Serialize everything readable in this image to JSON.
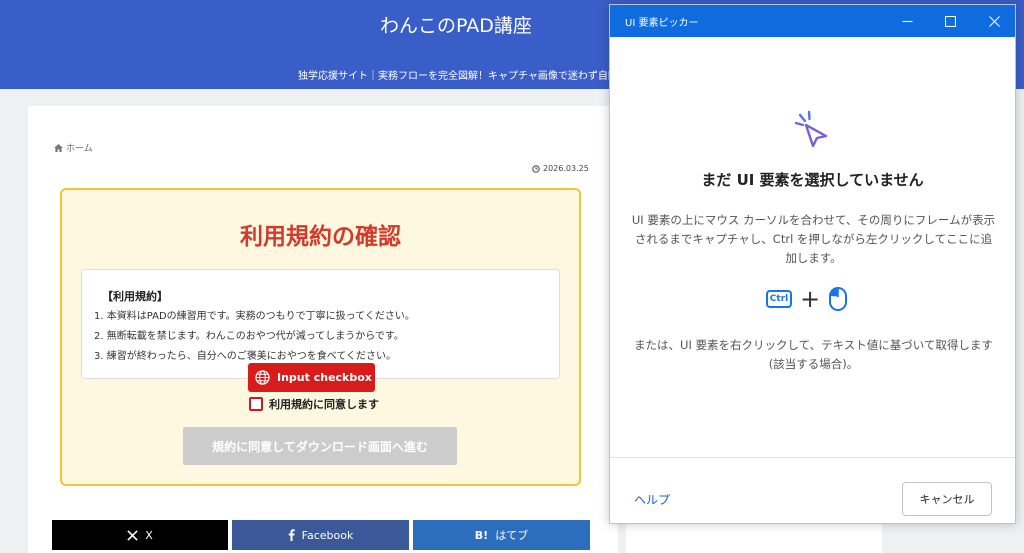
{
  "site": {
    "title": "わんこのPAD講座",
    "tagline": "独学応援サイト｜実務フローを完全図解！キャプチャ画像で迷わず自動化"
  },
  "post": {
    "breadcrumb_home": "ホーム",
    "date": "2026.03.25",
    "heading": "利用規約の確認",
    "terms_title": "【利用規約】",
    "terms_items": [
      "1. 本資料はPADの練習用です。実務のつもりで丁寧に扱ってください。",
      "2. 無断転載を禁じます。わんこのおやつ代が減ってしまうからです。",
      "3. 練習が終わったら、自分へのご褒美におやつを食べてください。"
    ],
    "tooltip_label": "Input checkbox",
    "agree_label": "利用規約に同意します",
    "proceed_button": "規約に同意してダウンロード画面へ進む"
  },
  "share": {
    "x_label": "X",
    "facebook_label": "Facebook",
    "hatena_icon_text": "B!",
    "hatena_label": "はてブ"
  },
  "dialog": {
    "title": "UI 要素ピッカー",
    "heading": "まだ UI 要素を選択していません",
    "description": "UI 要素の上にマウス カーソルを合わせて、その周りにフレームが表示されるまでキャプチャし、Ctrl を押しながら左クリックしてここに追加します。",
    "ctrl_key": "Ctrl",
    "plus": "+",
    "alternative": "または、UI 要素を右クリックして、テキスト値に基づいて取得します (該当する場合)。",
    "help_link": "ヘルプ",
    "cancel_button": "キャンセル"
  },
  "colors": {
    "header_blue": "#3a5ec7",
    "heading_red": "#d33a2c",
    "tooltip_red": "#d81b1b",
    "box_border": "#f2c43a",
    "dialog_blue": "#0f6cde"
  }
}
